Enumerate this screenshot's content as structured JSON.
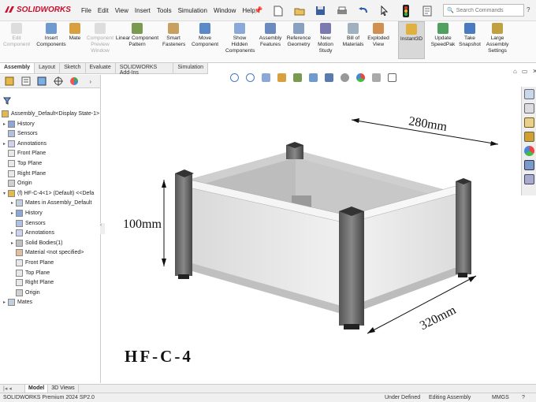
{
  "app": {
    "brand": "SOLIDWORKS",
    "accent": "#c8102e"
  },
  "menu": [
    "File",
    "Edit",
    "View",
    "Insert",
    "Tools",
    "Simulation",
    "Window",
    "Help"
  ],
  "search": {
    "placeholder": "Search Commands"
  },
  "help_label": "?",
  "ribbon": [
    {
      "label": "Edit\nComponent",
      "disabled": true,
      "icon": "edit-component-icon"
    },
    {
      "label": "Insert\nComponents",
      "disabled": false,
      "icon": "insert-components-icon"
    },
    {
      "label": "Mate",
      "disabled": false,
      "icon": "mate-icon"
    },
    {
      "label": "Component\nPreview\nWindow",
      "disabled": true,
      "icon": "preview-window-icon"
    },
    {
      "label": "Linear Component\nPattern",
      "disabled": false,
      "icon": "linear-pattern-icon"
    },
    {
      "label": "Smart\nFasteners",
      "disabled": false,
      "icon": "smart-fasteners-icon"
    },
    {
      "label": "Move\nComponent",
      "disabled": false,
      "icon": "move-component-icon"
    },
    {
      "label": "Show\nHidden\nComponents",
      "disabled": false,
      "icon": "show-hidden-icon"
    },
    {
      "label": "Assembly\nFeatures",
      "disabled": false,
      "icon": "assembly-features-icon"
    },
    {
      "label": "Reference\nGeometry",
      "disabled": false,
      "icon": "reference-geometry-icon"
    },
    {
      "label": "New\nMotion\nStudy",
      "disabled": false,
      "icon": "motion-study-icon"
    },
    {
      "label": "Bill of\nMaterials",
      "disabled": false,
      "icon": "bom-icon"
    },
    {
      "label": "Exploded\nView",
      "disabled": false,
      "icon": "exploded-view-icon"
    },
    {
      "label": "Instant3D",
      "disabled": false,
      "active": true,
      "icon": "instant3d-icon"
    },
    {
      "label": "Update\nSpeedPak",
      "disabled": false,
      "icon": "speedpak-icon"
    },
    {
      "label": "Take\nSnapshot",
      "disabled": false,
      "icon": "snapshot-icon"
    },
    {
      "label": "Large\nAssembly\nSettings",
      "disabled": false,
      "icon": "large-assembly-icon"
    }
  ],
  "tabs": [
    "Assembly",
    "Layout",
    "Sketch",
    "Evaluate",
    "SOLIDWORKS Add-Ins",
    "Simulation"
  ],
  "selected_tab": "Assembly",
  "tree": [
    {
      "label": "Assembly_Default<Display State-1>",
      "level": 0,
      "expand": ""
    },
    {
      "label": "History",
      "level": 1,
      "expand": "▸"
    },
    {
      "label": "Sensors",
      "level": 1,
      "expand": ""
    },
    {
      "label": "Annotations",
      "level": 1,
      "expand": "▸"
    },
    {
      "label": "Front Plane",
      "level": 1,
      "expand": ""
    },
    {
      "label": "Top Plane",
      "level": 1,
      "expand": ""
    },
    {
      "label": "Right Plane",
      "level": 1,
      "expand": ""
    },
    {
      "label": "Origin",
      "level": 1,
      "expand": ""
    },
    {
      "label": "(f) HF-C-4<1> (Default) <<Defa",
      "level": 1,
      "expand": "▾"
    },
    {
      "label": "Mates in Assembly_Default",
      "level": 2,
      "expand": "▸"
    },
    {
      "label": "History",
      "level": 2,
      "expand": "▸"
    },
    {
      "label": "Sensors",
      "level": 2,
      "expand": ""
    },
    {
      "label": "Annotations",
      "level": 2,
      "expand": "▸"
    },
    {
      "label": "Solid Bodies(1)",
      "level": 2,
      "expand": "▸"
    },
    {
      "label": "Material <not specified>",
      "level": 2,
      "expand": ""
    },
    {
      "label": "Front Plane",
      "level": 2,
      "expand": ""
    },
    {
      "label": "Top Plane",
      "level": 2,
      "expand": ""
    },
    {
      "label": "Right Plane",
      "level": 2,
      "expand": ""
    },
    {
      "label": "Origin",
      "level": 2,
      "expand": ""
    },
    {
      "label": "Mates",
      "level": 1,
      "expand": "▸"
    }
  ],
  "model": {
    "dim_width": "280mm",
    "dim_depth": "320mm",
    "dim_height": "100mm",
    "product_name": "HF-C-4"
  },
  "bottom_tabs": [
    "Model",
    "3D Views"
  ],
  "bottom_selected": "Model",
  "status": {
    "product": "SOLIDWORKS Premium 2024 SP2.0",
    "state": "Under Defined",
    "mode": "Editing Assembly",
    "units": "MMGS"
  }
}
